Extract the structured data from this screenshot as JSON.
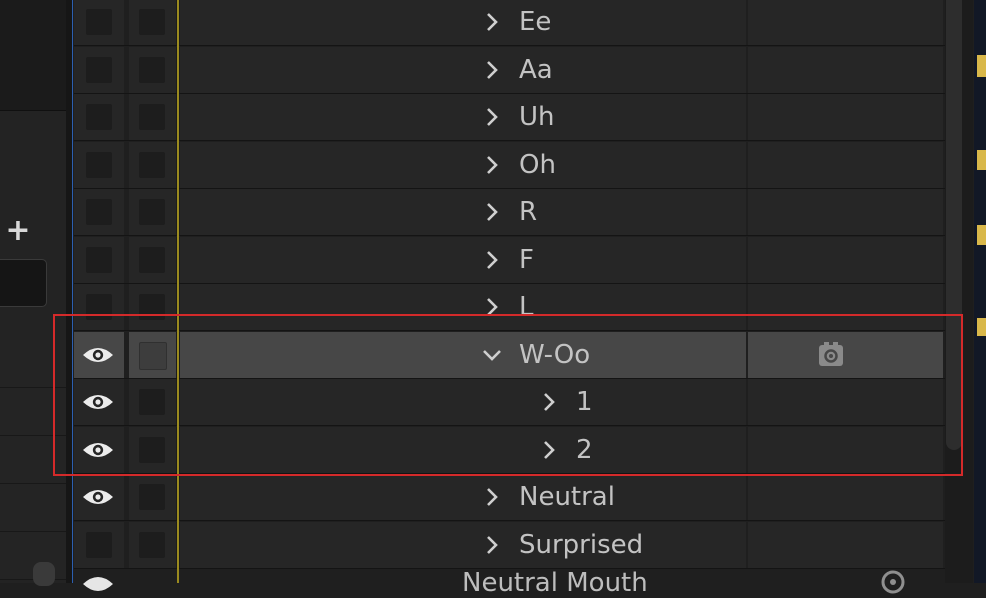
{
  "left_panel": {
    "add_button": "+"
  },
  "layers": [
    {
      "id": "ee",
      "label": "Ee",
      "expanded": false,
      "indent": 0,
      "visible": false,
      "selected": false
    },
    {
      "id": "aa",
      "label": "Aa",
      "expanded": false,
      "indent": 0,
      "visible": false,
      "selected": false
    },
    {
      "id": "uh",
      "label": "Uh",
      "expanded": false,
      "indent": 0,
      "visible": false,
      "selected": false
    },
    {
      "id": "oh",
      "label": "Oh",
      "expanded": false,
      "indent": 0,
      "visible": false,
      "selected": false
    },
    {
      "id": "r",
      "label": "R",
      "expanded": false,
      "indent": 0,
      "visible": false,
      "selected": false
    },
    {
      "id": "f",
      "label": "F",
      "expanded": false,
      "indent": 0,
      "visible": false,
      "selected": false
    },
    {
      "id": "l",
      "label": "L",
      "expanded": false,
      "indent": 0,
      "visible": false,
      "selected": false
    },
    {
      "id": "w-oo",
      "label": "W-Oo",
      "expanded": true,
      "indent": 0,
      "visible": true,
      "selected": true,
      "extra_icon": "gear-icon"
    },
    {
      "id": "1",
      "label": "1",
      "expanded": false,
      "indent": 1,
      "visible": true,
      "selected": false
    },
    {
      "id": "2",
      "label": "2",
      "expanded": false,
      "indent": 1,
      "visible": true,
      "selected": false
    },
    {
      "id": "neutral",
      "label": "Neutral",
      "expanded": false,
      "indent": 0,
      "visible": true,
      "selected": false
    },
    {
      "id": "surprised",
      "label": "Surprised",
      "expanded": false,
      "indent": 0,
      "visible": false,
      "selected": false
    }
  ],
  "partial_row": {
    "label": "Neutral Mouth"
  },
  "colors": {
    "highlight": "#d42a2a",
    "selected_row": "#474747",
    "timeline_marker": "#9a8a1f"
  }
}
